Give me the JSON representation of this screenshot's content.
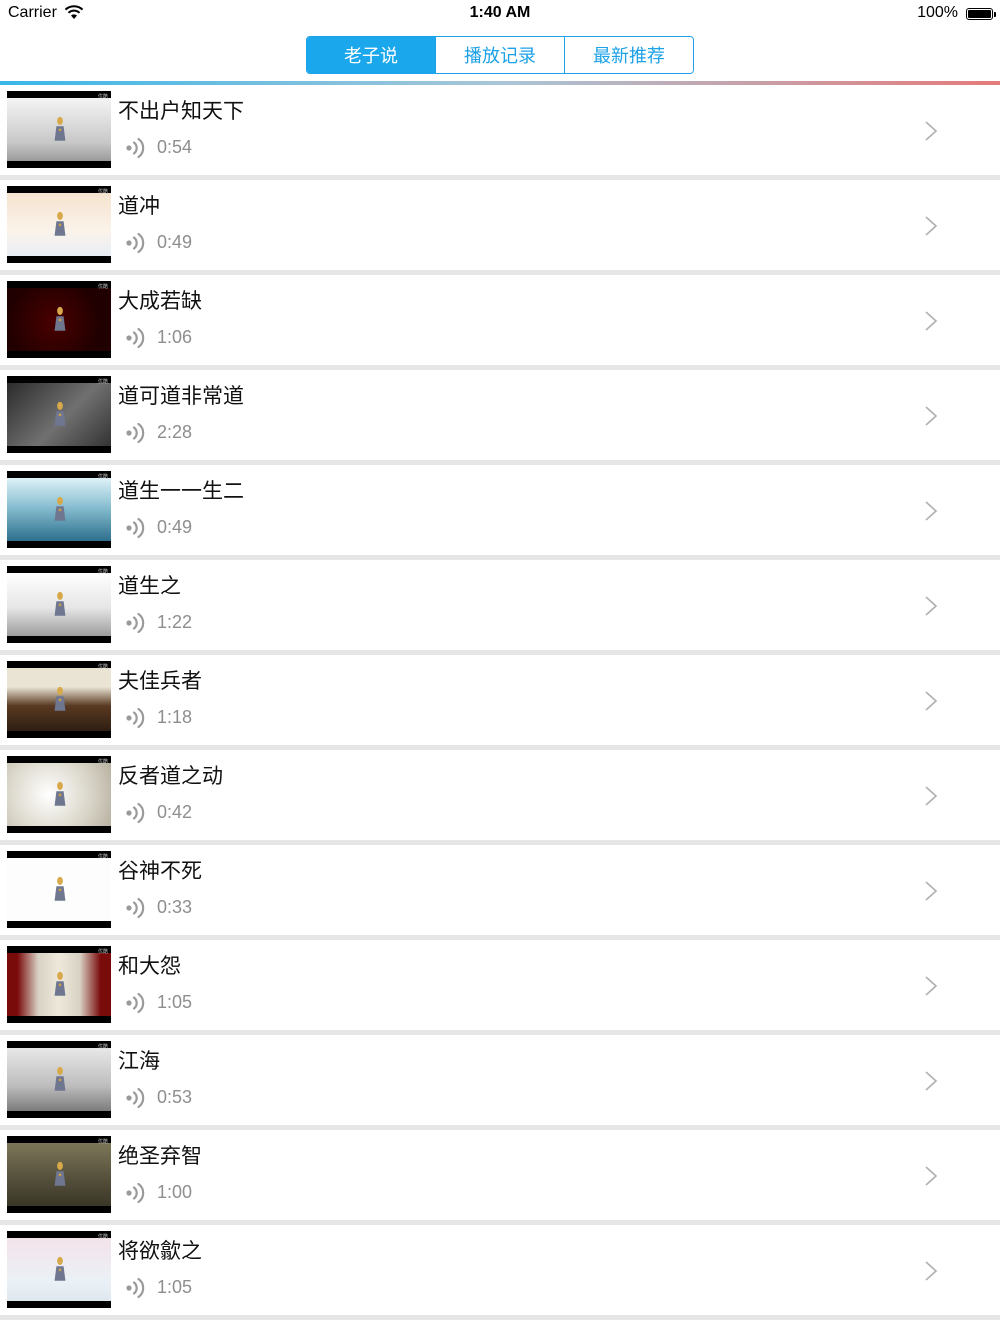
{
  "status_bar": {
    "carrier": "Carrier",
    "time": "1:40 AM",
    "battery": "100%"
  },
  "segments": [
    {
      "label": "老子说",
      "active": true
    },
    {
      "label": "播放记录",
      "active": false
    },
    {
      "label": "最新推荐",
      "active": false
    }
  ],
  "colors": {
    "accent": "#1aa7ec",
    "divider": "#e6e6e6",
    "duration_text": "#8e8e8e"
  },
  "items": [
    {
      "title": "不出户知天下",
      "duration": "0:54",
      "thumb": "sc-mist"
    },
    {
      "title": "道冲",
      "duration": "0:49",
      "thumb": "sc-peach"
    },
    {
      "title": "大成若缺",
      "duration": "1:06",
      "thumb": "sc-red"
    },
    {
      "title": "道可道非常道",
      "duration": "2:28",
      "thumb": "sc-dark"
    },
    {
      "title": "道生一一生二",
      "duration": "0:49",
      "thumb": "sc-sea"
    },
    {
      "title": "道生之",
      "duration": "1:22",
      "thumb": "sc-ink"
    },
    {
      "title": "夫佳兵者",
      "duration": "1:18",
      "thumb": "sc-hall"
    },
    {
      "title": "反者道之动",
      "duration": "0:42",
      "thumb": "sc-glow"
    },
    {
      "title": "谷神不死",
      "duration": "0:33",
      "thumb": "sc-white"
    },
    {
      "title": "和大怨",
      "duration": "1:05",
      "thumb": "sc-stage"
    },
    {
      "title": "江海",
      "duration": "0:53",
      "thumb": "sc-cloud"
    },
    {
      "title": "绝圣弃智",
      "duration": "1:00",
      "thumb": "sc-olive"
    },
    {
      "title": "将欲歙之",
      "duration": "1:05",
      "thumb": "sc-pink"
    }
  ]
}
